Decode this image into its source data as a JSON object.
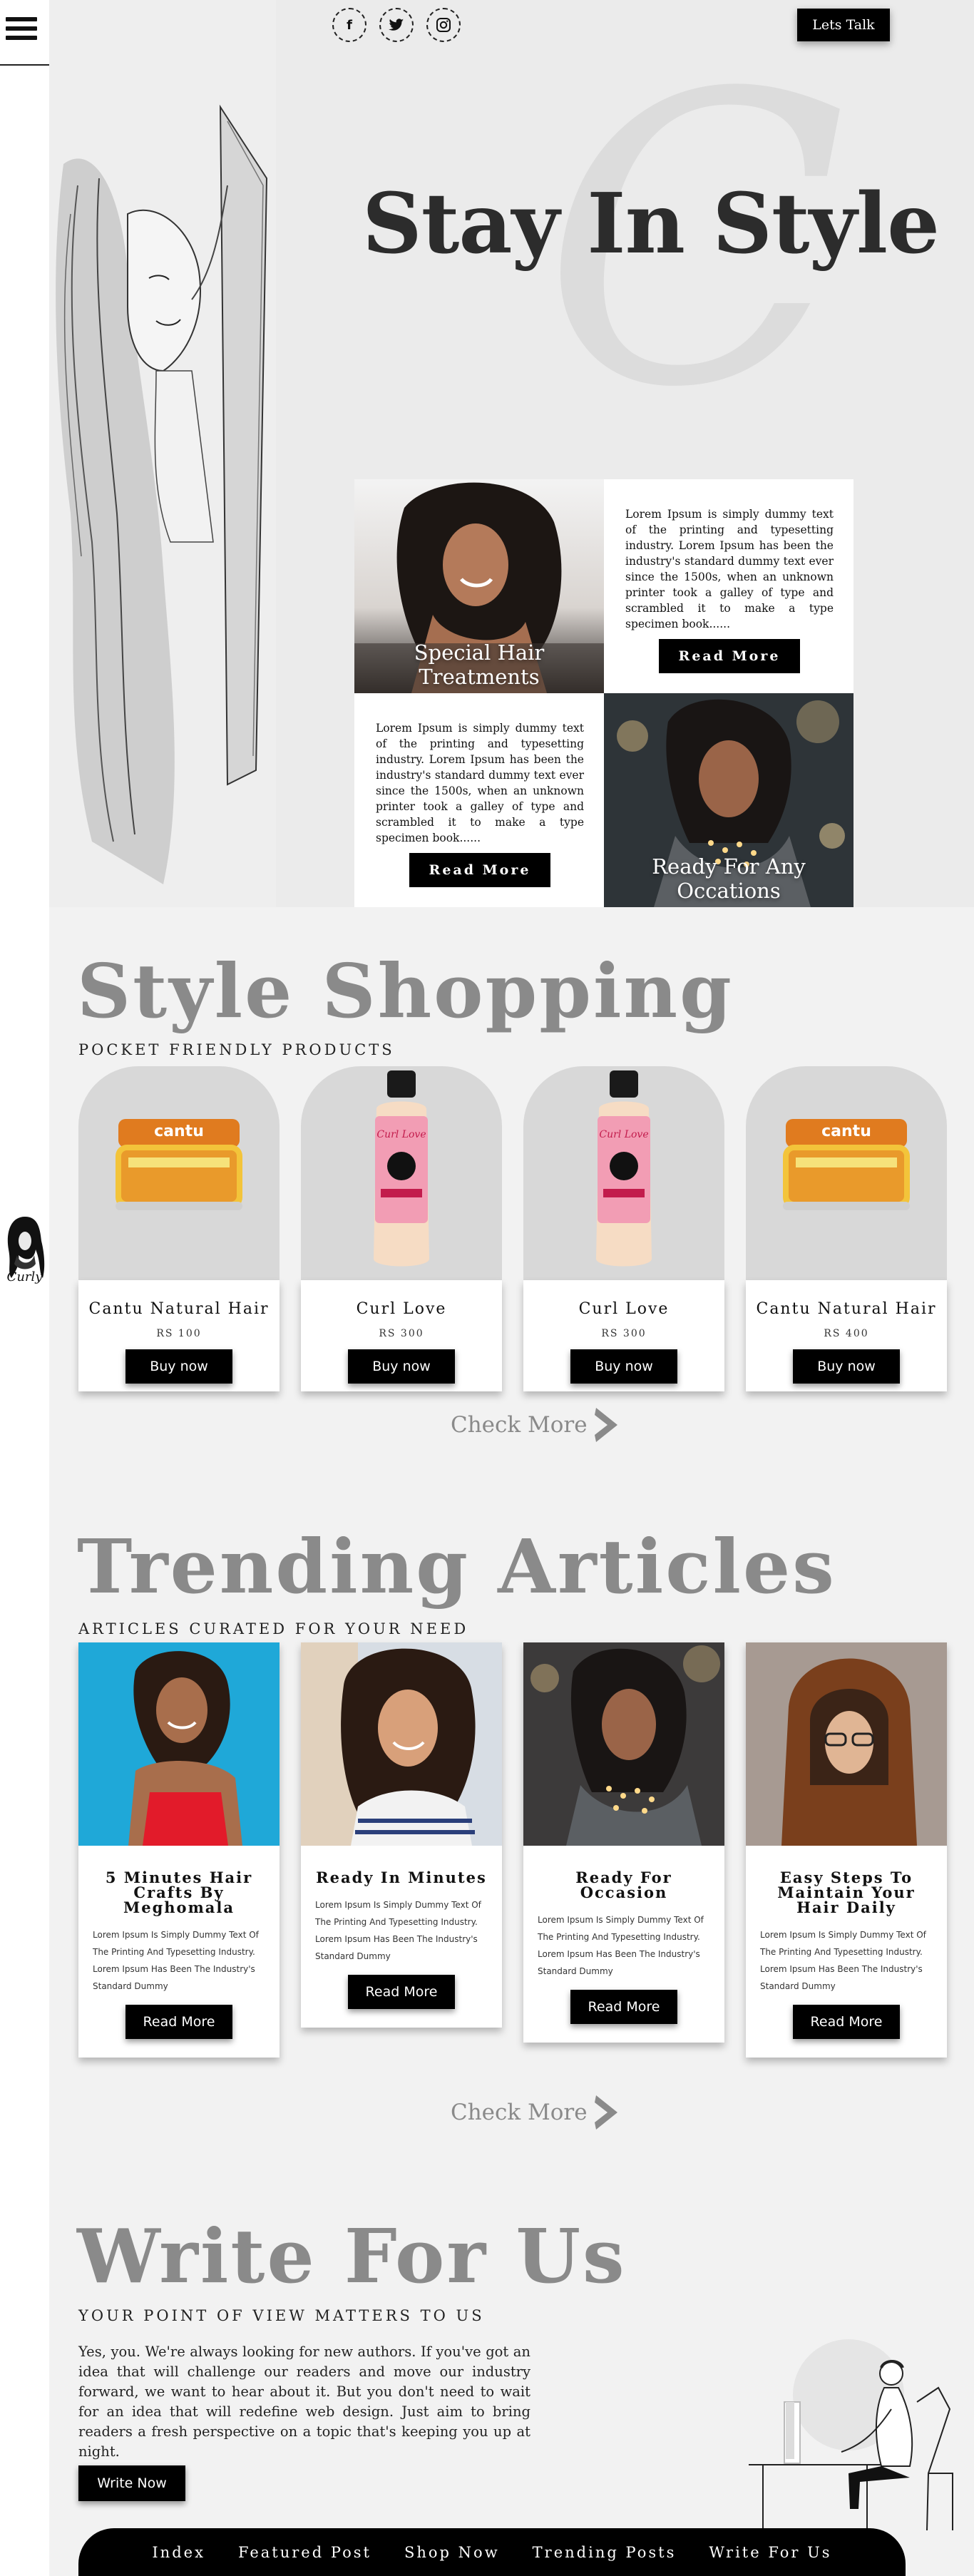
{
  "nav": {
    "menu_icon": "hamburger-menu-icon",
    "cta": "Lets Talk"
  },
  "socials": [
    {
      "icon": "facebook-icon",
      "glyph": "f"
    },
    {
      "icon": "twitter-icon",
      "glyph": "🐦"
    },
    {
      "icon": "instagram-icon",
      "glyph": "◎"
    }
  ],
  "brand": {
    "logo_text": "Curly"
  },
  "hero": {
    "watermark": "C",
    "title": "Stay In Style",
    "cards": [
      {
        "caption": "Special Hair Treatments"
      },
      {
        "text": "Lorem Ipsum is simply dummy text of the printing and typesetting industry. Lorem Ipsum has been the industry's standard dummy text ever since the 1500s, when an unknown printer took a galley of type and scrambled it to make a type specimen book......",
        "button": "Read More"
      },
      {
        "text": "Lorem Ipsum is simply dummy text of the printing and typesetting industry. Lorem Ipsum has been the industry's standard dummy text ever since the 1500s, when an unknown printer took a galley of type and scrambled it to make a type specimen book......",
        "button": "Read More"
      },
      {
        "caption": "Ready For Any Occations"
      }
    ]
  },
  "shopping": {
    "title": "Style Shopping",
    "subtitle": "Pocket Friendly Products",
    "products": [
      {
        "name": "Cantu Natural Hair",
        "price": "RS 100",
        "button": "Buy now",
        "kind": "jar"
      },
      {
        "name": "Curl Love",
        "price": "RS 300",
        "button": "Buy now",
        "kind": "bottle"
      },
      {
        "name": "Curl Love",
        "price": "RS 300",
        "button": "Buy now",
        "kind": "bottle"
      },
      {
        "name": "Cantu Natural Hair",
        "price": "RS 400",
        "button": "Buy now",
        "kind": "jar"
      }
    ],
    "jar_label": "cantu",
    "bottle_label": "Curl Love",
    "check_more": "Check More"
  },
  "articles": {
    "title": "Trending Articles",
    "subtitle": "Articles Curated For Your Need",
    "items": [
      {
        "title": "5 Minutes Hair Crafts By Meghomala",
        "body": "Lorem Ipsum Is Simply Dummy Text Of The Printing And Typesetting Industry. Lorem Ipsum Has Been The Industry's Standard Dummy",
        "button": "Read More",
        "bg": "#1fa8d8"
      },
      {
        "title": "Ready In Minutes",
        "body": "Lorem Ipsum Is Simply Dummy Text Of The Printing And Typesetting Industry. Lorem Ipsum Has Been The Industry's Standard Dummy",
        "button": "Read More",
        "bg": "#c9d2dc"
      },
      {
        "title": "Ready For Occasion",
        "body": "Lorem Ipsum Is Simply Dummy Text Of The Printing And Typesetting Industry. Lorem Ipsum Has Been The Industry's Standard Dummy",
        "button": "Read More",
        "bg": "#3c3a3a"
      },
      {
        "title": "Easy Steps To Maintain Your Hair Daily",
        "body": "Lorem Ipsum Is Simply Dummy Text Of The Printing And Typesetting Industry. Lorem Ipsum Has Been The Industry's Standard Dummy",
        "button": "Read More",
        "bg": "#9a8b82"
      }
    ],
    "check_more": "Check More"
  },
  "write": {
    "title": "Write For Us",
    "subtitle": "Your Point Of View Matters To Us",
    "body": "Yes, you. We're always looking for new authors. If you've got an idea that will challenge our readers and move our industry forward, we want to hear about it. But you don't need to wait for an idea that will redefine web design. Just aim to bring readers a fresh perspective on a topic that's keeping you up at night.",
    "button": "Write Now"
  },
  "footer": {
    "links": [
      "Index",
      "Featured Post",
      "Shop Now",
      "Trending Posts",
      "Write For Us"
    ]
  }
}
